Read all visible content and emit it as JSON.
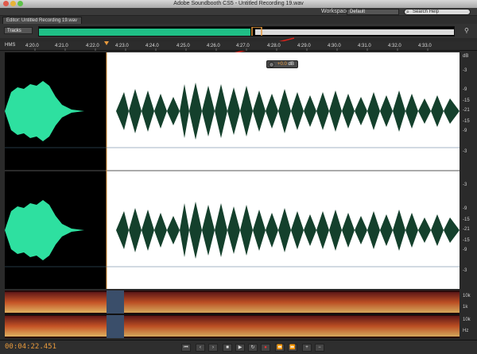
{
  "window": {
    "title": "Adobe Soundbooth CS5 - Untitled Recording 19.wav"
  },
  "toolbar": {
    "workspace_label": "Workspace:",
    "workspace_value": "Default",
    "search_placeholder": "Search Help"
  },
  "editor": {
    "tab_label": "Editor: Untitled Recording 19.wav",
    "tracks_label": "Tracks"
  },
  "ruler": {
    "hms_label": "HMS",
    "ticks": [
      "4:20.0",
      "4:21.0",
      "4:22.0",
      "4:23.0",
      "4:24.0",
      "4:25.0",
      "4:26.0",
      "4:27.0",
      "4:28.0",
      "4:29.0",
      "4:30.0",
      "4:31.0",
      "4:32.0",
      "4:33.0"
    ]
  },
  "hud": {
    "value": "+0.0",
    "unit": "dB"
  },
  "db_scale": [
    "dB",
    "-3",
    "-9",
    "-15",
    "-21",
    "-15",
    "-9",
    "-3",
    "-3",
    "-9",
    "-15",
    "-21",
    "-15",
    "-9",
    "-3"
  ],
  "spec_scale": [
    "10k",
    "1k",
    "10k",
    "Hz"
  ],
  "transport": {
    "timecode": "00:04:22.451"
  },
  "colors": {
    "accent": "#e89a3c",
    "wave_selected": "#2ee0a0",
    "wave_unselected": "#14402c",
    "red_arrow": "#d9231a"
  }
}
